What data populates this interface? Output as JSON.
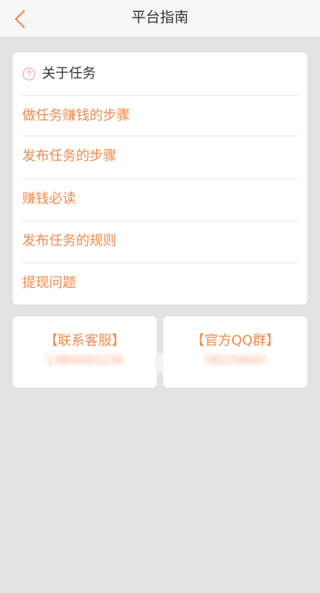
{
  "header": {
    "title": "平台指南",
    "back_icon": "chevron-left-icon",
    "back_color": "#f08a4b"
  },
  "menu": {
    "header_icon": "question-circle-icon",
    "header_icon_color": "#f5a3c7",
    "header_label": "关于任务",
    "items": [
      {
        "label": "做任务赚钱的步骤"
      },
      {
        "label": "发布任务的步骤"
      },
      {
        "label": "赚钱必读"
      },
      {
        "label": "发布任务的规则"
      },
      {
        "label": "提现问题"
      }
    ]
  },
  "contacts": [
    {
      "label": "【联系客服】",
      "value": "13800001234"
    },
    {
      "label": "【官方QQ群】",
      "value": "781234567"
    }
  ],
  "colors": {
    "accent": "#f08a4b",
    "background": "#e3e3e3",
    "card": "#ffffff"
  }
}
